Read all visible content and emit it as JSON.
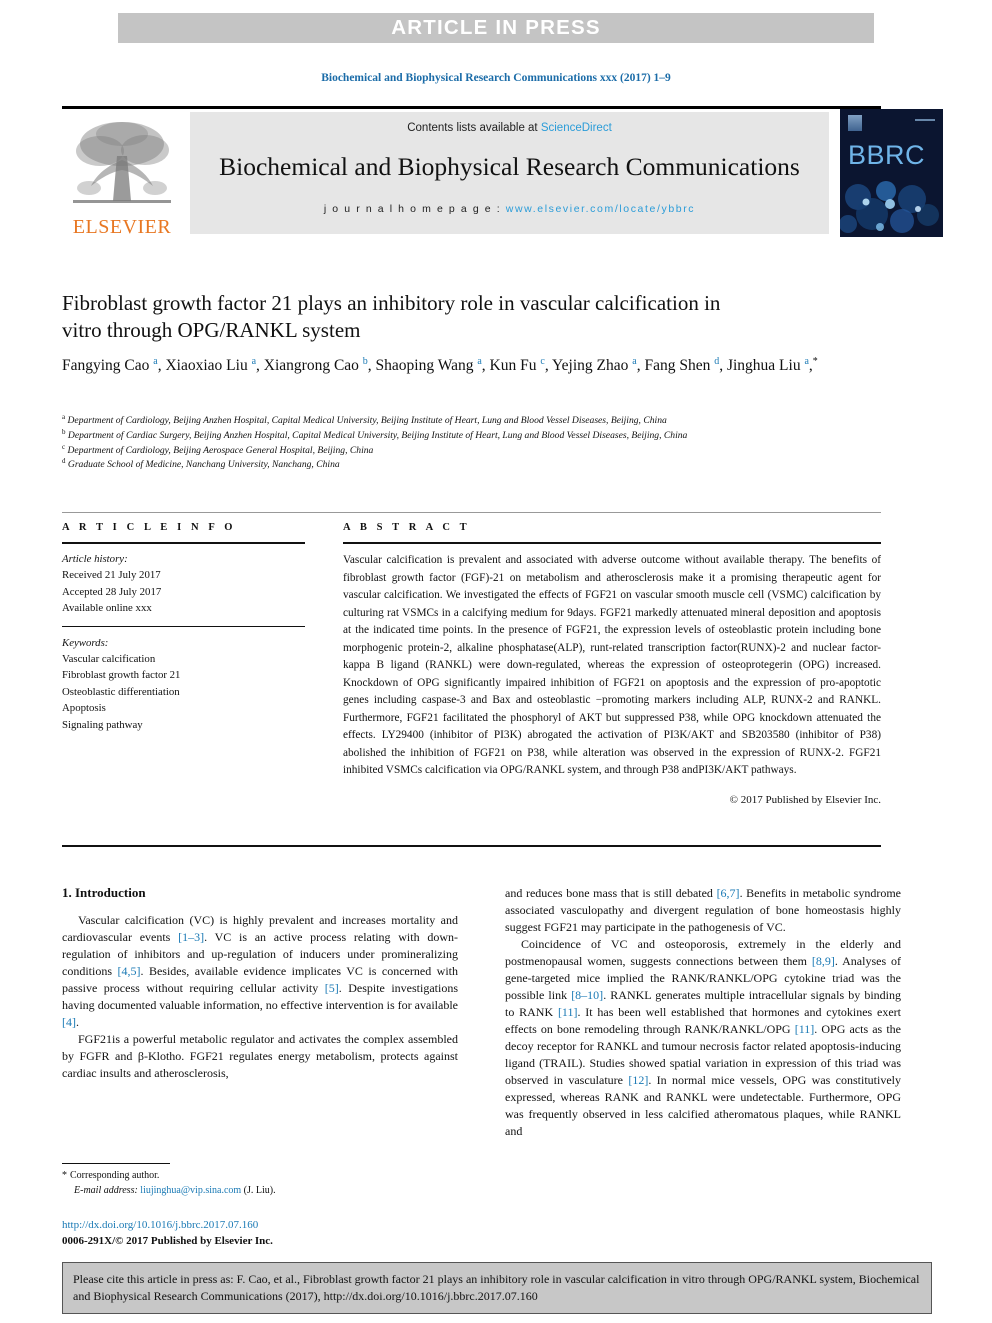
{
  "banner": {
    "text": "ARTICLE IN PRESS"
  },
  "running_head": "Biochemical and Biophysical Research Communications xxx (2017) 1–9",
  "masthead": {
    "contents_prefix": "Contents lists available at ",
    "sciencedirect": "ScienceDirect",
    "journal_title": "Biochemical and Biophysical Research Communications",
    "homepage_prefix": "j o u r n a l  h o m e p a g e :  ",
    "homepage_url": "www.elsevier.com/locate/ybbrc",
    "publisher_wordmark": "ELSEVIER",
    "cover_wordmark": "BBRC"
  },
  "article": {
    "title": "Fibroblast growth factor 21 plays an inhibitory role in vascular calcification in vitro through OPG/RANKL system",
    "authors_html": "Fangying Cao <sup>a</sup>, Xiaoxiao Liu <sup>a</sup>, Xiangrong Cao <sup>b</sup>, Shaoping Wang <sup>a</sup>, Kun Fu <sup>c</sup>, Yejing Zhao <sup>a</sup>, Fang Shen <sup>d</sup>, Jinghua Liu <sup>a</sup>,<sup class=\"star\">*</sup>",
    "affiliations": [
      {
        "mark": "a",
        "text": "Department of Cardiology, Beijing Anzhen Hospital, Capital Medical University, Beijing Institute of Heart, Lung and Blood Vessel Diseases, Beijing, China"
      },
      {
        "mark": "b",
        "text": "Department of Cardiac Surgery, Beijing Anzhen Hospital, Capital Medical University, Beijing Institute of Heart, Lung and Blood Vessel Diseases, Beijing, China"
      },
      {
        "mark": "c",
        "text": "Department of Cardiology, Beijing Aerospace General Hospital, Beijing, China"
      },
      {
        "mark": "d",
        "text": "Graduate School of Medicine, Nanchang University, Nanchang, China"
      }
    ]
  },
  "info": {
    "heading": "A R T I C L E   I N F O",
    "history_label": "Article history:",
    "history": [
      "Received 21 July 2017",
      "Accepted 28 July 2017",
      "Available online xxx"
    ],
    "keywords_label": "Keywords:",
    "keywords": [
      "Vascular calcification",
      "Fibroblast growth factor 21",
      "Osteoblastic differentiation",
      "Apoptosis",
      "Signaling pathway"
    ]
  },
  "abstract": {
    "heading": "A B S T R A C T",
    "text": "Vascular calcification is prevalent and associated with adverse outcome without available therapy. The benefits of fibroblast growth factor (FGF)-21 on metabolism and atherosclerosis make it a promising therapeutic agent for vascular calcification. We investigated the effects of FGF21 on vascular smooth muscle cell (VSMC) calcification by culturing rat VSMCs in a calcifying medium for 9days. FGF21 markedly attenuated mineral deposition and apoptosis at the indicated time points. In the presence of FGF21, the expression levels of osteoblastic protein including bone morphogenic protein-2, alkaline phosphatase(ALP), runt-related transcription factor(RUNX)-2 and nuclear factor-kappa B ligand (RANKL) were down-regulated, whereas the expression of osteoprotegerin (OPG) increased. Knockdown of OPG significantly impaired inhibition of FGF21 on apoptosis and the expression of pro-apoptotic genes including caspase-3 and Bax and osteoblastic −promoting markers including ALP, RUNX-2 and RANKL. Furthermore, FGF21 facilitated the phosphoryl of AKT but suppressed P38, while OPG knockdown attenuated the effects. LY29400 (inhibitor of PI3K) abrogated the activation of PI3K/AKT and SB203580 (inhibitor of P38) abolished the inhibition of FGF21 on P38, while alteration was observed in the expression of RUNX-2. FGF21 inhibited VSMCs calcification via OPG/RANKL system, and through P38 andPI3K/AKT pathways.",
    "copyright": "© 2017 Published by Elsevier Inc."
  },
  "intro": {
    "heading": "1. Introduction",
    "left_paras": [
      "Vascular calcification (VC) is highly prevalent and increases mortality and cardiovascular events <span class=\"ref\">[1–3]</span>. VC is an active process relating with down-regulation of inhibitors and up-regulation of inducers under promineralizing conditions <span class=\"ref\">[4,5]</span>. Besides, available evidence implicates VC is concerned with passive process without requiring cellular activity <span class=\"ref\">[5]</span>. Despite investigations having documented valuable information, no effective intervention is for available <span class=\"ref\">[4]</span>.",
      "FGF21is a powerful metabolic regulator and activates the complex assembled by FGFR and β-Klotho. FGF21 regulates energy metabolism, protects against cardiac insults and atherosclerosis,"
    ],
    "right_paras": [
      "and reduces bone mass that is still debated <span class=\"ref\">[6,7]</span>. Benefits in metabolic syndrome associated vasculopathy and divergent regulation of bone homeostasis highly suggest FGF21 may participate in the pathogenesis of VC.",
      "Coincidence of VC and osteoporosis, extremely in the elderly and postmenopausal women, suggests connections between them <span class=\"ref\">[8,9]</span>. Analyses of gene-targeted mice implied the RANK/RANKL/OPG cytokine triad was the possible link <span class=\"ref\">[8–10]</span>. RANKL generates multiple intracellular signals by binding to RANK <span class=\"ref\">[11]</span>. It has been well established that hormones and cytokines exert effects on bone remodeling through RANK/RANKL/OPG <span class=\"ref\">[11]</span>. OPG acts as the decoy receptor for RANKL and tumour necrosis factor related apoptosis-inducing ligand (TRAIL). Studies showed spatial variation in expression of this triad was observed in vasculature <span class=\"ref\">[12]</span>. In normal mice vessels, OPG was constitutively expressed, whereas RANK and RANKL were undetectable. Furthermore, OPG was frequently observed in less calcified atheromatous plaques, while RANKL and"
    ]
  },
  "footnote": {
    "star": "*",
    "corresponding": "Corresponding author.",
    "email_label": "E-mail address:",
    "email": "liujinghua@vip.sina.com",
    "email_owner": "(J. Liu)."
  },
  "doi": {
    "url": "http://dx.doi.org/10.1016/j.bbrc.2017.07.160",
    "issn_line": "0006-291X/© 2017 Published by Elsevier Inc."
  },
  "citation_box": {
    "text": "Please cite this article in press as: F. Cao, et al., Fibroblast growth factor 21 plays an inhibitory role in vascular calcification in vitro through OPG/RANKL system, Biochemical and Biophysical Research Communications (2017), http://dx.doi.org/10.1016/j.bbrc.2017.07.160"
  },
  "colors": {
    "banner_gray": "#c4c4c4",
    "link_blue": "#1b7ab5",
    "sciencedirect_blue": "#2b9cd8",
    "elsevier_orange": "#E87722",
    "cover_navy": "#0b1530",
    "masthead_gray": "#e6e6e6",
    "cite_gray": "#c7c7c7"
  }
}
